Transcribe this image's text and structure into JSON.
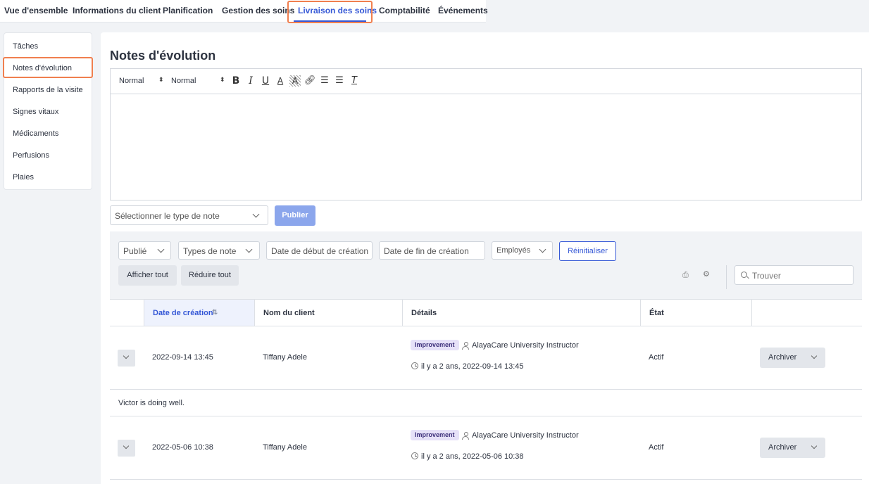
{
  "topnav": {
    "tabs": [
      {
        "label": "Vue d'ensemble"
      },
      {
        "label": "Informations du client"
      },
      {
        "label": "Planification"
      },
      {
        "label": "Gestion des soins"
      },
      {
        "label": "Livraison des soins",
        "active": true
      },
      {
        "label": "Comptabilité"
      },
      {
        "label": "Événements"
      }
    ]
  },
  "sidebar": {
    "items": [
      {
        "label": "Tâches"
      },
      {
        "label": "Notes d'évolution",
        "active": true
      },
      {
        "label": "Rapports de la visite"
      },
      {
        "label": "Signes vitaux"
      },
      {
        "label": "Médicaments"
      },
      {
        "label": "Perfusions"
      },
      {
        "label": "Plaies"
      }
    ]
  },
  "page": {
    "title": "Notes d'évolution"
  },
  "editor": {
    "heading_select": "Normal",
    "size_select": "Normal",
    "buttons": [
      "bold-icon",
      "italic-icon",
      "underline-icon",
      "text-color-icon",
      "background-color-icon",
      "link-icon",
      "ordered-list-icon",
      "bullet-list-icon",
      "clear-format-icon"
    ]
  },
  "compose": {
    "note_type_placeholder": "Sélectionner le type de note",
    "publish_label": "Publier"
  },
  "filters": {
    "status": "Publié",
    "note_types": "Types de note",
    "start_date_placeholder": "Date de début de création",
    "end_date_placeholder": "Date de fin de création",
    "employees": "Employés",
    "reset_label": "Réinitialiser",
    "expand_all_label": "Afficher tout",
    "collapse_all_label": "Réduire tout",
    "search_placeholder": "Trouver"
  },
  "table": {
    "columns": [
      "Date de création",
      "Nom du client",
      "Détails",
      "État"
    ],
    "rows": [
      {
        "date": "2022-09-14 13:45",
        "client": "Tiffany Adele",
        "tag": "Improvement",
        "author": "AlayaCare University Instructor",
        "ago": "il y a 2 ans, 2022-09-14 13:45",
        "status": "Actif",
        "action": "Archiver",
        "note": "Victor is doing well."
      },
      {
        "date": "2022-05-06 10:38",
        "client": "Tiffany Adele",
        "tag": "Improvement",
        "author": "AlayaCare University Instructor",
        "ago": "il y a 2 ans, 2022-05-06 10:38",
        "status": "Actif",
        "action": "Archiver"
      }
    ]
  },
  "colors": {
    "accent": "#3558d6",
    "highlight": "#f07f4f",
    "publish": "#8ba6ec",
    "tag_bg": "#e6e1f8"
  }
}
